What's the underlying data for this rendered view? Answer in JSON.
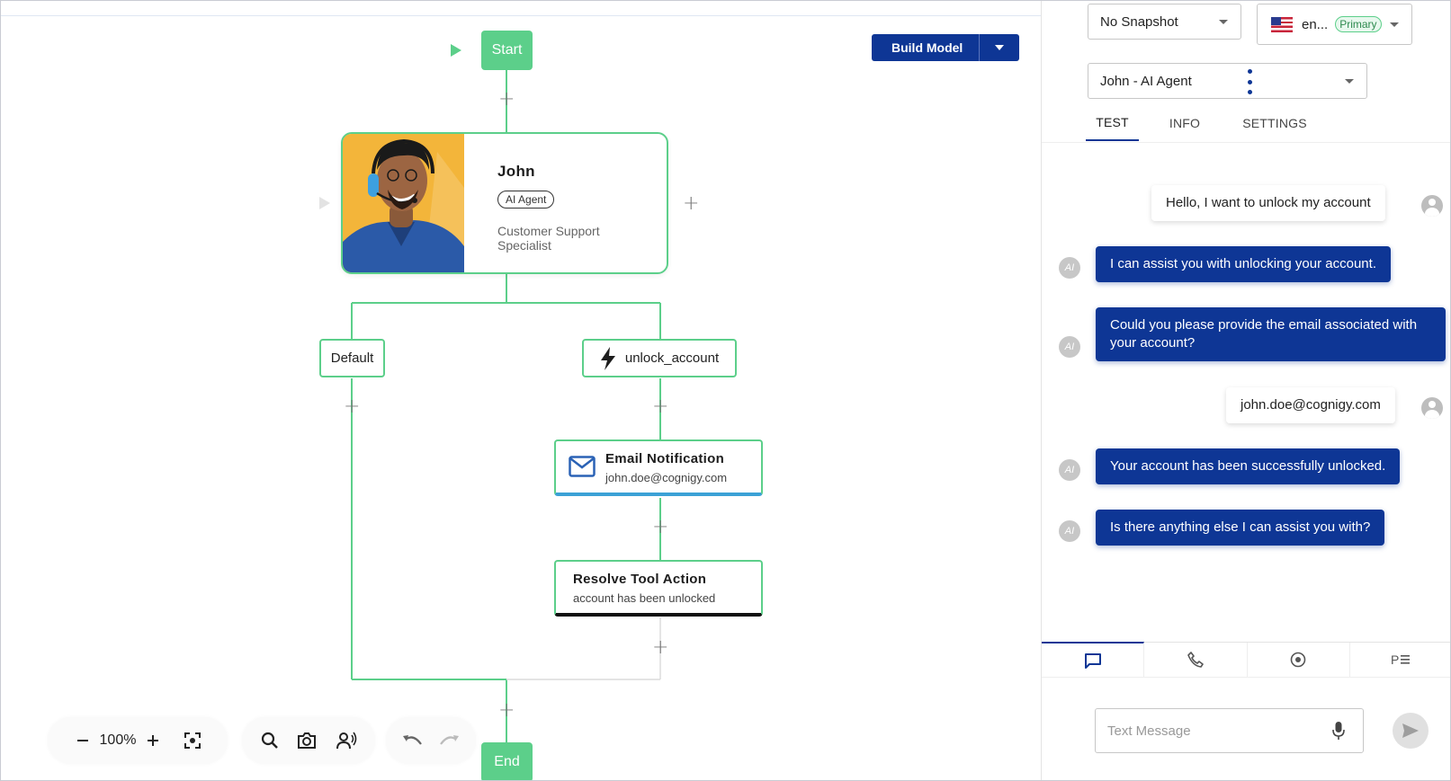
{
  "canvas": {
    "start_label": "Start",
    "end_label": "End",
    "build_button": {
      "label": "Build Model"
    },
    "agent": {
      "name": "John",
      "badge": "AI Agent",
      "role": "Customer Support Specialist"
    },
    "branches": {
      "default_label": "Default",
      "tool_label": "unlock_account"
    },
    "email_node": {
      "title": "Email Notification",
      "subtitle": "john.doe@cognigy.com"
    },
    "resolve_node": {
      "title": "Resolve Tool Action",
      "subtitle": "account has been unlocked"
    },
    "toolbar": {
      "zoom": "100%"
    },
    "colors": {
      "node_green": "#5ccf8a",
      "email_accent": "#3ba1d6",
      "brand_blue": "#0e3695"
    }
  },
  "panel": {
    "snapshot_select": "No Snapshot",
    "locale_select": {
      "value": "en...",
      "badge": "Primary",
      "flag": "us-flag-icon"
    },
    "agent_select": "John - AI Agent",
    "tabs": [
      {
        "label": "TEST",
        "active": true
      },
      {
        "label": "INFO",
        "active": false
      },
      {
        "label": "SETTINGS",
        "active": false
      }
    ],
    "messages": [
      {
        "from": "user",
        "text": "Hello, I want to unlock my account"
      },
      {
        "from": "bot",
        "text": "I can assist you with unlocking your account."
      },
      {
        "from": "bot",
        "text": "Could you please provide the email associated with your account?"
      },
      {
        "from": "user",
        "text": "john.doe@cognigy.com"
      },
      {
        "from": "bot",
        "text": "Your account has been successfully unlocked."
      },
      {
        "from": "bot",
        "text": "Is there anything else I can assist you with?"
      }
    ],
    "bottom_tabs": [
      "chat-icon",
      "phone-icon",
      "record-icon",
      "playbook-icon"
    ],
    "text_input": {
      "placeholder": "Text Message"
    }
  }
}
